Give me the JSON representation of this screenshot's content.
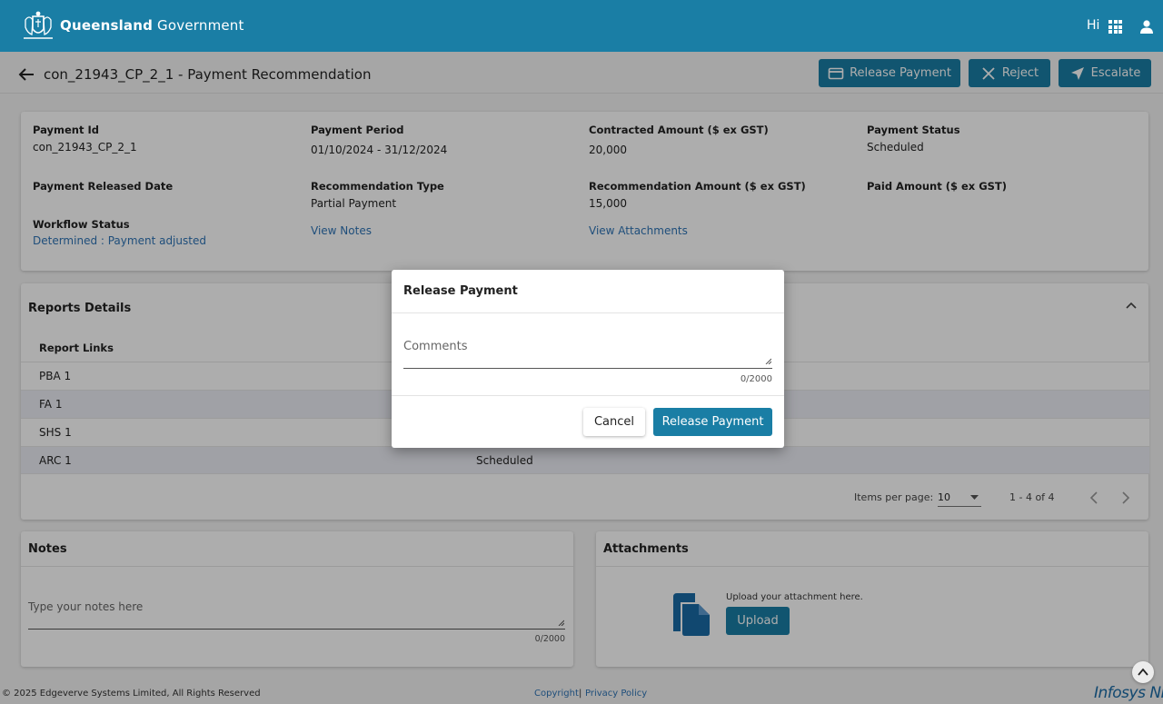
{
  "header": {
    "brand_bold": "Queensland",
    "brand_light": " Government",
    "greeting": "Hi"
  },
  "title_bar": {
    "page_title": "con_21943_CP_2_1 - Payment Recommendation",
    "release_label": "Release Payment",
    "reject_label": "Reject",
    "escalate_label": "Escalate"
  },
  "summary": {
    "payment_id_label": "Payment Id",
    "payment_id": "con_21943_CP_2_1",
    "payment_period_label": "Payment Period",
    "payment_period": "01/10/2024 - 31/12/2024",
    "contracted_label": "Contracted Amount ($ ex GST)",
    "contracted": "20,000",
    "status_label": "Payment Status",
    "status": "Scheduled",
    "released_date_label": "Payment Released Date",
    "rec_type_label": "Recommendation Type",
    "rec_type": "Partial Payment",
    "rec_amount_label": "Recommendation Amount ($ ex GST)",
    "rec_amount": "15,000",
    "paid_label": "Paid Amount ($ ex GST)",
    "workflow_label": "Workflow Status",
    "workflow": "Determined : Payment adjusted",
    "view_notes": "View Notes",
    "view_attachments": "View Attachments"
  },
  "reports": {
    "title": "Reports Details",
    "column_header": "Report Links",
    "rows": [
      {
        "name": "PBA 1",
        "status": ""
      },
      {
        "name": "FA 1",
        "status": ""
      },
      {
        "name": "SHS 1",
        "status": ""
      },
      {
        "name": "ARC 1",
        "status": "Scheduled"
      }
    ],
    "items_per_page_label": "Items per page:",
    "items_per_page": "10",
    "range": "1 - 4 of 4"
  },
  "notes": {
    "title": "Notes",
    "placeholder": "Type your notes here",
    "counter": "0/2000"
  },
  "attachments": {
    "title": "Attachments",
    "hint": "Upload your attachment here.",
    "upload_label": "Upload"
  },
  "footer": {
    "copyright": "© 2025 Edgeverve Systems Limited, All Rights Reserved",
    "copyright_link": "Copyright",
    "separator": "|",
    "privacy": "Privacy Policy",
    "logo_text": "Infosys NI"
  },
  "modal": {
    "title": "Release Payment",
    "comments_label": "Comments",
    "counter": "0/2000",
    "cancel_label": "Cancel",
    "confirm_label": "Release Payment"
  },
  "colors": {
    "brand": "#1a7ea5",
    "link": "#2e74b5"
  }
}
